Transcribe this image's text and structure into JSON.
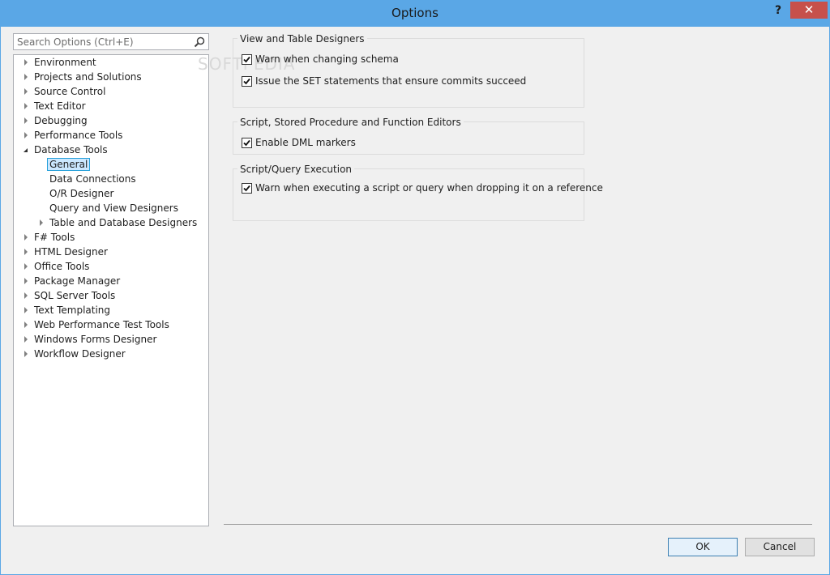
{
  "window": {
    "title": "Options",
    "help_label": "?",
    "close_label": "✕"
  },
  "search": {
    "placeholder": "Search Options (Ctrl+E)",
    "value": ""
  },
  "tree": {
    "items": [
      {
        "label": "Environment",
        "state": "collapsed",
        "level": 0
      },
      {
        "label": "Projects and Solutions",
        "state": "collapsed",
        "level": 0
      },
      {
        "label": "Source Control",
        "state": "collapsed",
        "level": 0
      },
      {
        "label": "Text Editor",
        "state": "collapsed",
        "level": 0
      },
      {
        "label": "Debugging",
        "state": "collapsed",
        "level": 0
      },
      {
        "label": "Performance Tools",
        "state": "collapsed",
        "level": 0
      },
      {
        "label": "Database Tools",
        "state": "expanded",
        "level": 0
      },
      {
        "label": "General",
        "state": "leaf",
        "level": 1,
        "selected": true
      },
      {
        "label": "Data Connections",
        "state": "leaf",
        "level": 1
      },
      {
        "label": "O/R Designer",
        "state": "leaf",
        "level": 1
      },
      {
        "label": "Query and View Designers",
        "state": "leaf",
        "level": 1
      },
      {
        "label": "Table and Database Designers",
        "state": "collapsed",
        "level": 1
      },
      {
        "label": "F# Tools",
        "state": "collapsed",
        "level": 0
      },
      {
        "label": "HTML Designer",
        "state": "collapsed",
        "level": 0
      },
      {
        "label": "Office Tools",
        "state": "collapsed",
        "level": 0
      },
      {
        "label": "Package Manager",
        "state": "collapsed",
        "level": 0
      },
      {
        "label": "SQL Server Tools",
        "state": "collapsed",
        "level": 0
      },
      {
        "label": "Text Templating",
        "state": "collapsed",
        "level": 0
      },
      {
        "label": "Web Performance Test Tools",
        "state": "collapsed",
        "level": 0
      },
      {
        "label": "Windows Forms Designer",
        "state": "collapsed",
        "level": 0
      },
      {
        "label": "Workflow Designer",
        "state": "collapsed",
        "level": 0
      }
    ]
  },
  "groups": {
    "view_table": {
      "title": "View and Table Designers",
      "options": [
        {
          "label": "Warn when changing schema",
          "checked": true
        },
        {
          "label": "Issue the SET statements that ensure commits succeed",
          "checked": true
        }
      ]
    },
    "script_editors": {
      "title": "Script, Stored Procedure and Function Editors",
      "options": [
        {
          "label": "Enable DML markers",
          "checked": true
        }
      ]
    },
    "query_execution": {
      "title": "Script/Query Execution",
      "options": [
        {
          "label": "Warn when executing a script or query when dropping it on a reference",
          "checked": true
        }
      ]
    }
  },
  "buttons": {
    "ok_label": "OK",
    "cancel_label": "Cancel"
  },
  "watermark": "SOFTPEDIA",
  "colors": {
    "titlebar": "#5aa7e6",
    "close": "#c7504b",
    "selection": "#cce8ff"
  },
  "icons": {
    "search": "search-icon",
    "close": "close-icon",
    "help": "help-icon",
    "checkmark": "checkmark-icon"
  }
}
